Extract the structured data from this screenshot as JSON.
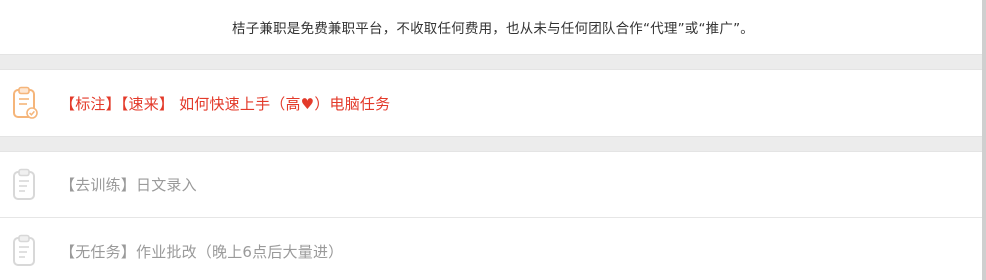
{
  "notice": {
    "text": "桔子兼职是免费兼职平台，不收取任何费用，也从未与任何团队合作“代理”或“推广”。"
  },
  "tasks": [
    {
      "label": "【标注】【速来】 如何快速上手（高♥）电脑任务",
      "icon": "clipboard-icon",
      "color": "#e33a2a",
      "icon_color": "#f5b57a"
    },
    {
      "label": "【去训练】日文录入",
      "icon": "clipboard-icon",
      "color": "#9a9a9a",
      "icon_color": "#d8d8d8"
    },
    {
      "label": "【无任务】作业批改（晚上6点后大量进）",
      "icon": "clipboard-icon",
      "color": "#9a9a9a",
      "icon_color": "#d8d8d8"
    }
  ]
}
